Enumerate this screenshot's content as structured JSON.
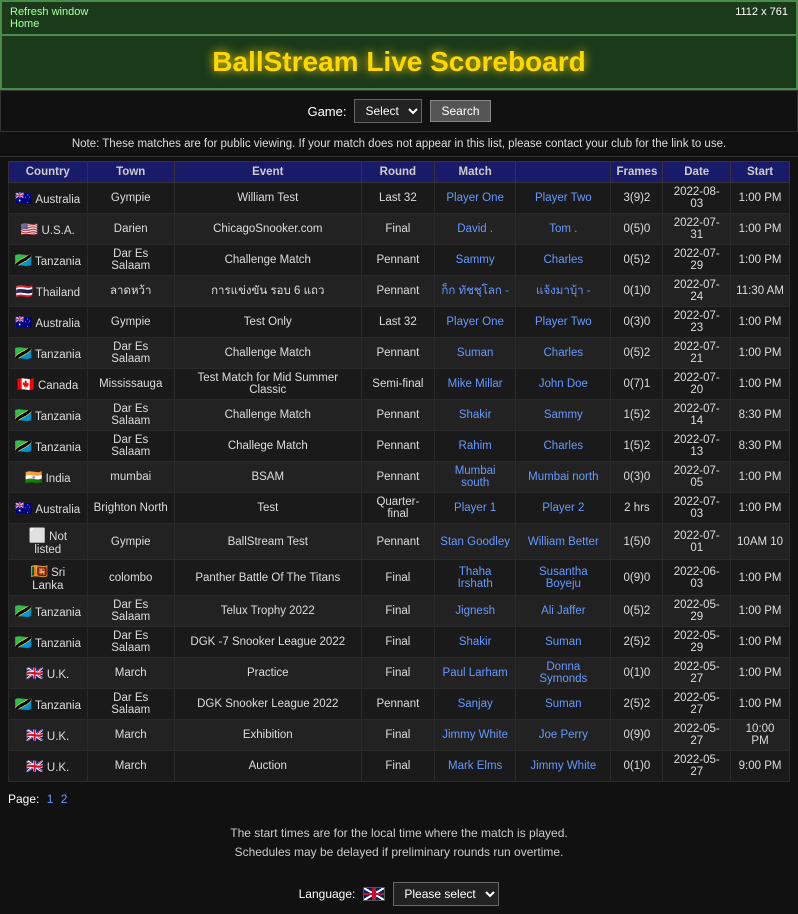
{
  "topbar": {
    "left_line1": "Refresh window",
    "left_line2": "Home",
    "right": "1112 x 761"
  },
  "header": {
    "title": "BallStream Live Scoreboard"
  },
  "game_select": {
    "label": "Game:",
    "placeholder": "Select",
    "search_button": "Search"
  },
  "note": "Note: These matches are for public viewing. If your match does not appear in this list, please contact your club for the link to use.",
  "table": {
    "headers": [
      "Country",
      "Town",
      "Event",
      "Round",
      "Match",
      "",
      "Frames",
      "Date",
      "Start"
    ],
    "rows": [
      {
        "country": "Australia",
        "flag": "au",
        "town": "Gympie",
        "event": "William Test",
        "round": "Last 32",
        "player1": "Player One",
        "player2": "Player Two",
        "frames": "3(9)2",
        "date": "2022-08-03",
        "start": "1:00 PM"
      },
      {
        "country": "U.S.A.",
        "flag": "us",
        "town": "Darien",
        "event": "ChicagoSnooker.com",
        "round": "Final",
        "player1": "David .",
        "player2": "Tom .",
        "frames": "0(5)0",
        "date": "2022-07-31",
        "start": "1:00 PM"
      },
      {
        "country": "Tanzania",
        "flag": "tz",
        "town": "Dar Es Salaam",
        "event": "Challenge Match",
        "round": "Pennant",
        "player1": "Sammy",
        "player2": "Charles",
        "frames": "0(5)2",
        "date": "2022-07-29",
        "start": "1:00 PM"
      },
      {
        "country": "Thailand",
        "flag": "th",
        "town": "ลาดหว้า",
        "event": "การแข่งขัน รอบ 6 แถว",
        "round": "Pennant",
        "player1": "ก็ก ทัชชุโลก -",
        "player2": "แจ้งมาบุ้า -",
        "frames": "0(1)0",
        "date": "2022-07-24",
        "start": "11:30 AM"
      },
      {
        "country": "Australia",
        "flag": "au",
        "town": "Gympie",
        "event": "Test Only",
        "round": "Last 32",
        "player1": "Player One",
        "player2": "Player Two",
        "frames": "0(3)0",
        "date": "2022-07-23",
        "start": "1:00 PM"
      },
      {
        "country": "Tanzania",
        "flag": "tz",
        "town": "Dar Es Salaam",
        "event": "Challenge Match",
        "round": "Pennant",
        "player1": "Suman",
        "player2": "Charles",
        "frames": "0(5)2",
        "date": "2022-07-21",
        "start": "1:00 PM"
      },
      {
        "country": "Canada",
        "flag": "ca",
        "town": "Mississauga",
        "event": "Test Match for Mid Summer Classic",
        "round": "Semi-final",
        "player1": "Mike Millar",
        "player2": "John Doe",
        "frames": "0(7)1",
        "date": "2022-07-20",
        "start": "1:00 PM"
      },
      {
        "country": "Tanzania",
        "flag": "tz",
        "town": "Dar Es Salaam",
        "event": "Challenge Match",
        "round": "Pennant",
        "player1": "Shakir",
        "player2": "Sammy",
        "frames": "1(5)2",
        "date": "2022-07-14",
        "start": "8:30 PM"
      },
      {
        "country": "Tanzania",
        "flag": "tz",
        "town": "Dar Es Salaam",
        "event": "Challege Match",
        "round": "Pennant",
        "player1": "Rahim",
        "player2": "Charles",
        "frames": "1(5)2",
        "date": "2022-07-13",
        "start": "8:30 PM"
      },
      {
        "country": "India",
        "flag": "in",
        "town": "mumbai",
        "event": "BSAM",
        "round": "Pennant",
        "player1": "Mumbai south",
        "player2": "Mumbai north",
        "frames": "0(3)0",
        "date": "2022-07-05",
        "start": "1:00 PM"
      },
      {
        "country": "Australia",
        "flag": "au",
        "town": "Brighton North",
        "event": "Test",
        "round": "Quarter-final",
        "player1": "Player 1",
        "player2": "Player 2",
        "frames": "2 hrs",
        "date": "2022-07-03",
        "start": "1:00 PM"
      },
      {
        "country": "Not listed",
        "flag": "none",
        "town": "Gympie",
        "event": "BallStream Test",
        "round": "Pennant",
        "player1": "Stan Goodley",
        "player2": "William Better",
        "frames": "1(5)0",
        "date": "2022-07-01",
        "start": "10AM 10"
      },
      {
        "country": "Sri Lanka",
        "flag": "lk",
        "town": "colombo",
        "event": "Panther Battle Of The Titans",
        "round": "Final",
        "player1": "Thaha Irshath",
        "player2": "Susantha Boyeju",
        "frames": "0(9)0",
        "date": "2022-06-03",
        "start": "1:00 PM"
      },
      {
        "country": "Tanzania",
        "flag": "tz",
        "town": "Dar Es Salaam",
        "event": "Telux Trophy 2022",
        "round": "Final",
        "player1": "Jignesh",
        "player2": "Ali Jaffer",
        "frames": "0(5)2",
        "date": "2022-05-29",
        "start": "1:00 PM"
      },
      {
        "country": "Tanzania",
        "flag": "tz",
        "town": "Dar Es Salaam",
        "event": "DGK -7 Snooker League 2022",
        "round": "Final",
        "player1": "Shakir",
        "player2": "Suman",
        "frames": "2(5)2",
        "date": "2022-05-29",
        "start": "1:00 PM"
      },
      {
        "country": "U.K.",
        "flag": "uk",
        "town": "March",
        "event": "Practice",
        "round": "Final",
        "player1": "Paul Larham",
        "player2": "Donna Symonds",
        "frames": "0(1)0",
        "date": "2022-05-27",
        "start": "1:00 PM"
      },
      {
        "country": "Tanzania",
        "flag": "tz",
        "town": "Dar Es Salaam",
        "event": "DGK Snooker League 2022",
        "round": "Pennant",
        "player1": "Sanjay",
        "player2": "Suman",
        "frames": "2(5)2",
        "date": "2022-05-27",
        "start": "1:00 PM"
      },
      {
        "country": "U.K.",
        "flag": "uk",
        "town": "March",
        "event": "Exhibition",
        "round": "Final",
        "player1": "Jimmy White",
        "player2": "Joe Perry",
        "frames": "0(9)0",
        "date": "2022-05-27",
        "start": "10:00 PM"
      },
      {
        "country": "U.K.",
        "flag": "uk",
        "town": "March",
        "event": "Auction",
        "round": "Final",
        "player1": "Mark Elms",
        "player2": "Jimmy White",
        "frames": "0(1)0",
        "date": "2022-05-27",
        "start": "9:00 PM"
      }
    ]
  },
  "pagination": {
    "label": "Page:",
    "page1": "1",
    "page2": "2"
  },
  "footer": {
    "line1": "The start times are for the local time where the match is played.",
    "line2": "Schedules may be delayed if preliminary rounds run overtime."
  },
  "language": {
    "label": "Language:",
    "select_placeholder": "Please select"
  }
}
